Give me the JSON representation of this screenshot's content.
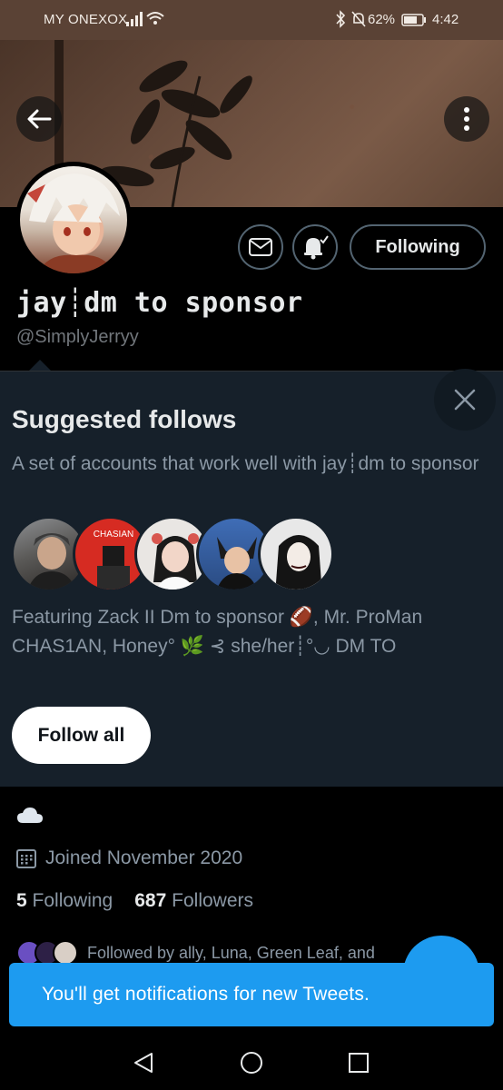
{
  "status_bar": {
    "carrier": "MY ONEXOX",
    "battery": "62%",
    "time": "4:42",
    "icons": [
      "signal-icon",
      "wifi-icon",
      "bluetooth-icon",
      "mute-icon",
      "battery-icon"
    ]
  },
  "profile": {
    "display_name": "jay┊dm to sponsor",
    "handle": "@SimplyJerryy",
    "following_button": "Following",
    "bio_icon": "cloud-icon",
    "joined": "Joined November 2020",
    "following_count": "5",
    "following_label": "Following",
    "followers_count": "687",
    "followers_label": "Followers",
    "followed_by": "Followed by ally, Luna, Green Leaf, and"
  },
  "suggested": {
    "title": "Suggested follows",
    "description": "A set of accounts that work well with jay┊dm to sponsor",
    "featuring": "Featuring Zack II Dm to sponsor 🏈, Mr. ProMan CHAS1AN, Honey° 🌿 ⊰ she/her┊°◡ DM TO",
    "follow_all": "Follow all",
    "avatar_label": "CHASIAN"
  },
  "toast": {
    "message": "You'll get notifications for new Tweets."
  },
  "colors": {
    "accent": "#1d9bf0",
    "card_bg": "#16202a",
    "muted_text": "#8b98a5",
    "status_bar": "#5a4235"
  }
}
